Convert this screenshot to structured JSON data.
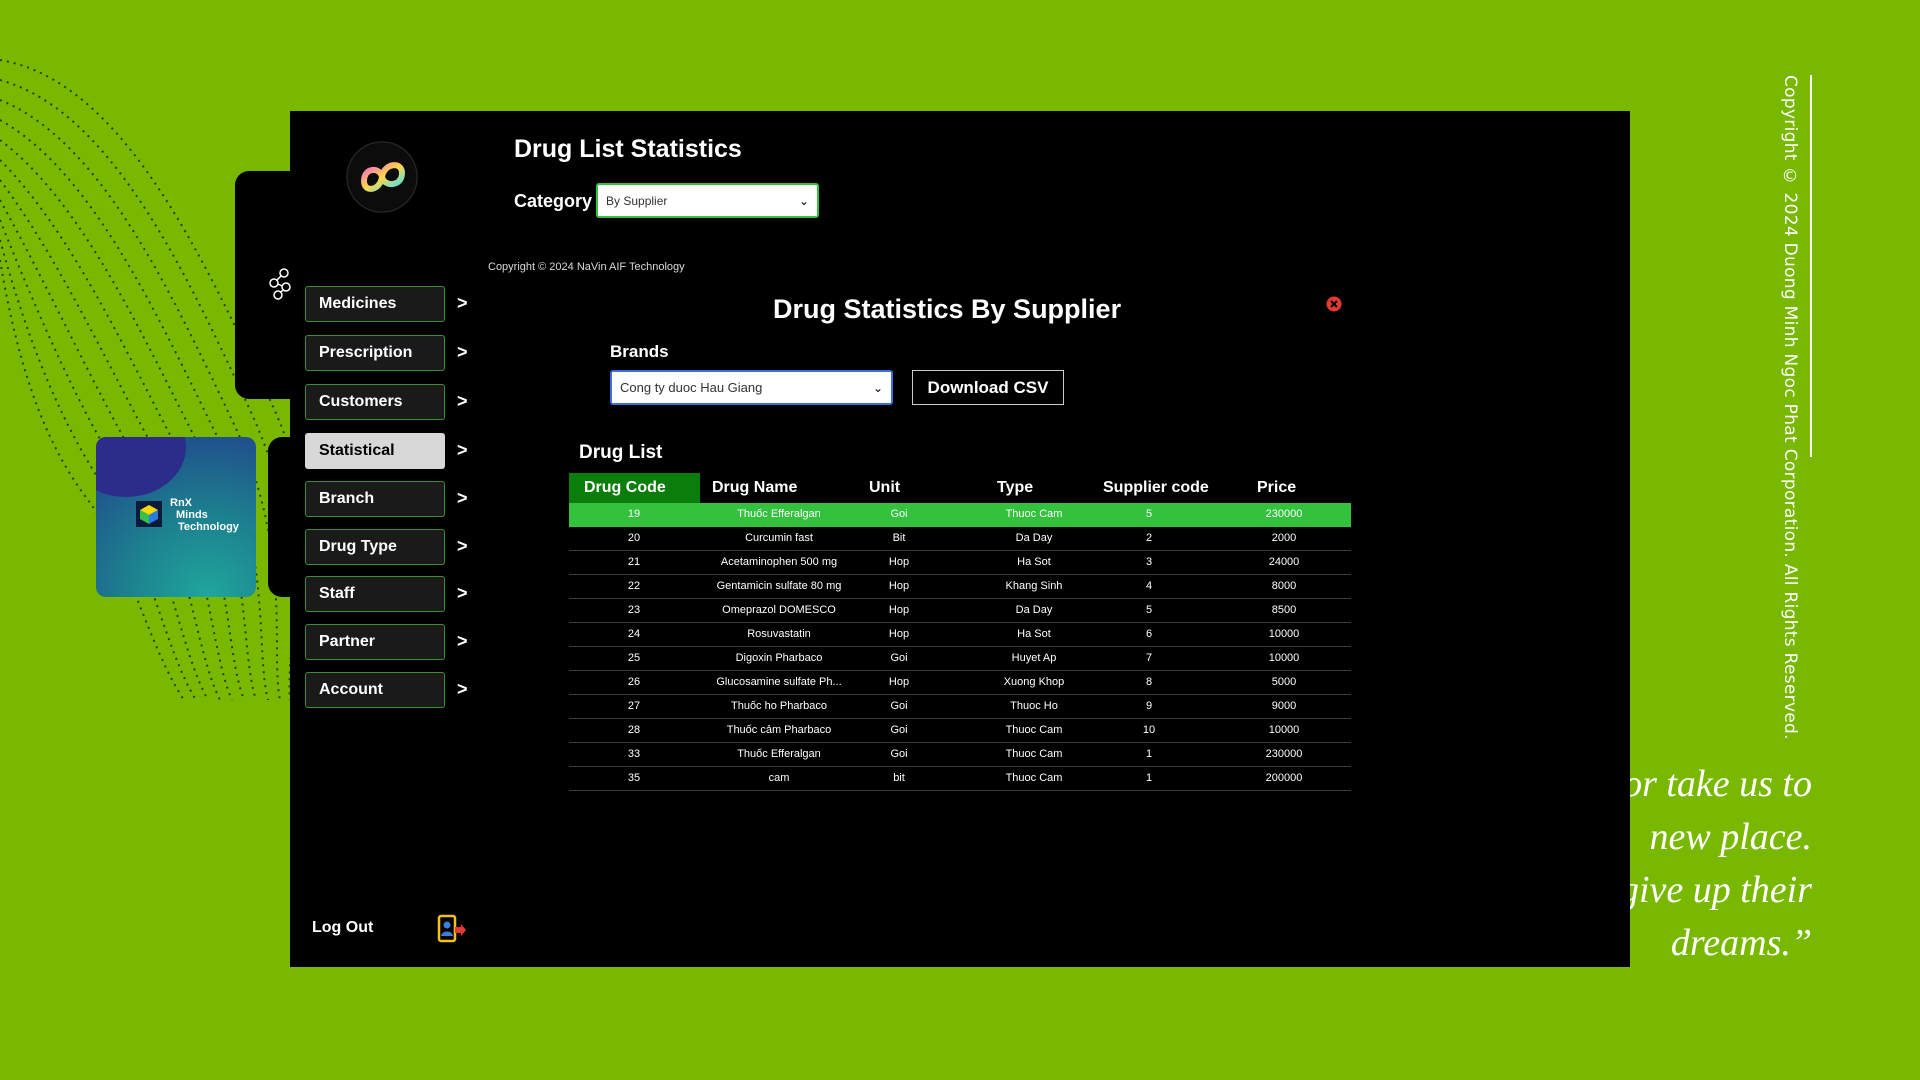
{
  "app": {
    "title": "Drug List Statistics",
    "category_label": "Category",
    "category_value": "By Supplier",
    "copyright_small": "Copyright © 2024 NaVin AIF Technology"
  },
  "nav": {
    "items": [
      {
        "label": "Medicines",
        "active": false
      },
      {
        "label": "Prescription",
        "active": false
      },
      {
        "label": "Customers",
        "active": false
      },
      {
        "label": "Statistical",
        "active": true
      },
      {
        "label": "Branch",
        "active": false
      },
      {
        "label": "Drug Type",
        "active": false
      },
      {
        "label": "Staff",
        "active": false
      },
      {
        "label": "Partner",
        "active": false
      },
      {
        "label": "Account",
        "active": false
      }
    ],
    "arrow": ">",
    "logout": "Log Out"
  },
  "stats": {
    "title": "Drug Statistics By Supplier",
    "brands_label": "Brands",
    "brand_value": "Cong ty duoc Hau Giang",
    "download_label": "Download CSV",
    "list_title": "Drug List"
  },
  "table": {
    "columns": [
      "Drug Code",
      "Drug Name",
      "Unit",
      "Type",
      "Supplier code",
      "Price"
    ],
    "rows": [
      [
        "19",
        "Thuốc Efferalgan",
        "Goi",
        "Thuoc Cam",
        "5",
        "230000"
      ],
      [
        "20",
        "Curcumin fast",
        "Bit",
        "Da Day",
        "2",
        "2000"
      ],
      [
        "21",
        "Acetaminophen 500 mg",
        "Hop",
        "Ha Sot",
        "3",
        "24000"
      ],
      [
        "22",
        "Gentamicin sulfate 80 mg",
        "Hop",
        "Khang Sinh",
        "4",
        "8000"
      ],
      [
        "23",
        "Omeprazol DOMESCO",
        "Hop",
        "Da Day",
        "5",
        "8500"
      ],
      [
        "24",
        "Rosuvastatin",
        "Hop",
        "Ha Sot",
        "6",
        "10000"
      ],
      [
        "25",
        "Digoxin Pharbaco",
        "Goi",
        "Huyet Ap",
        "7",
        "10000"
      ],
      [
        "26",
        "Glucosamine sulfate Ph...",
        "Hop",
        "Xuong Khop",
        "8",
        "5000"
      ],
      [
        "27",
        "Thuốc ho Pharbaco",
        "Goi",
        "Thuoc Ho",
        "9",
        "9000"
      ],
      [
        "28",
        "Thuốc cảm Pharbaco",
        "Goi",
        "Thuoc Cam",
        "10",
        "10000"
      ],
      [
        "33",
        "Thuốc Efferalgan",
        "Goi",
        "Thuoc Cam",
        "1",
        "230000"
      ],
      [
        "35",
        "cam",
        "bit",
        "Thuoc Cam",
        "1",
        "200000"
      ]
    ],
    "selected_row": 0
  },
  "rnx": {
    "line1": "RnX",
    "line2": "Minds",
    "line3": "Technology"
  },
  "backdrop": {
    "copyright_vertical": "Copyright © 2024 Duong Minh Ngoc Phat Corporation. All Rights Reserved.",
    "quote_lines": [
      "or take us to",
      "new place.",
      "give up their",
      "dreams.”"
    ]
  },
  "colors": {
    "background": "#79b800",
    "accent": "#33c13e",
    "header_accent": "#0b7d0b",
    "panel": "#000000"
  },
  "icons": {
    "close": "close-circle-icon",
    "logout": "logout-icon",
    "network": "network-icon",
    "logo": "infinity-logo-icon",
    "dropdown": "chevron-down-icon"
  }
}
